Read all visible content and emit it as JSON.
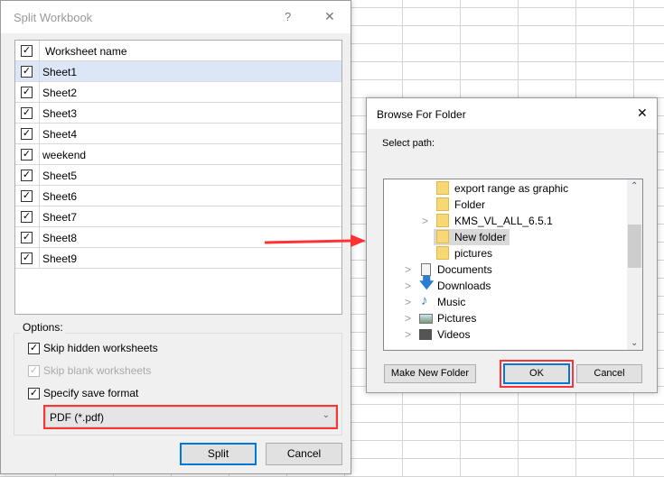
{
  "split_dialog": {
    "title": "Split Workbook",
    "help": "?",
    "close": "✕",
    "column_header": "Worksheet name",
    "sheets": [
      {
        "name": "Sheet1",
        "checked": true,
        "selected": true
      },
      {
        "name": "Sheet2",
        "checked": true
      },
      {
        "name": "Sheet3",
        "checked": true
      },
      {
        "name": "Sheet4",
        "checked": true
      },
      {
        "name": "weekend",
        "checked": true
      },
      {
        "name": "Sheet5",
        "checked": true
      },
      {
        "name": "Sheet6",
        "checked": true
      },
      {
        "name": "Sheet7",
        "checked": true
      },
      {
        "name": "Sheet8",
        "checked": true
      },
      {
        "name": "Sheet9",
        "checked": true
      }
    ],
    "options_label": "Options:",
    "skip_hidden": "Skip hidden worksheets",
    "skip_blank": "Skip blank worksheets",
    "specify_format": "Specify save format",
    "format_value": "PDF (*.pdf)",
    "split_button": "Split",
    "cancel_button": "Cancel"
  },
  "browse_dialog": {
    "title": "Browse For Folder",
    "close": "✕",
    "select_path": "Select path:",
    "tree": {
      "export": "export range as graphic",
      "folder": "Folder",
      "kms": "KMS_VL_ALL_6.5.1",
      "new_folder": "New folder",
      "pictures_sub": "pictures",
      "documents": "Documents",
      "downloads": "Downloads",
      "music": "Music",
      "pictures": "Pictures",
      "videos": "Videos"
    },
    "make_new_folder": "Make New Folder",
    "ok": "OK",
    "cancel": "Cancel"
  },
  "colors": {
    "highlight": "#ff3333",
    "selection": "#dce6f7",
    "accent": "#0078d7"
  }
}
